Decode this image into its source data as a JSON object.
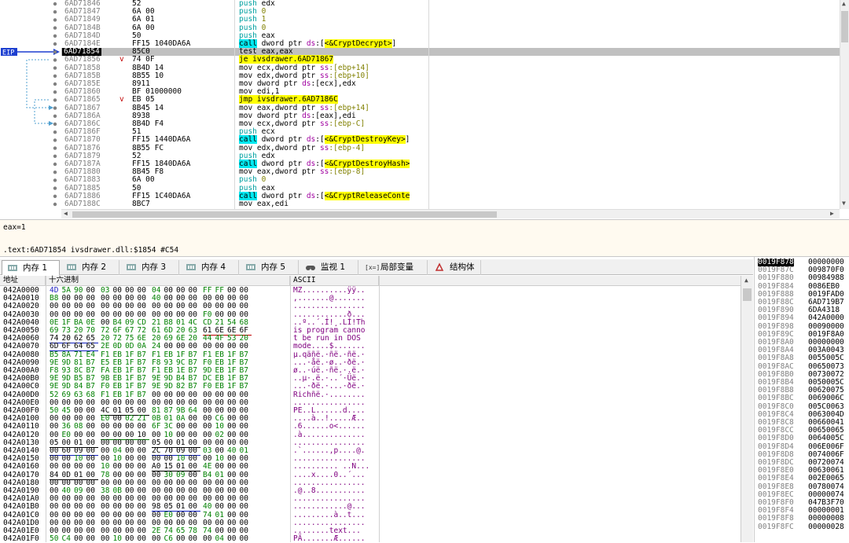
{
  "disasm": {
    "eip_label": "EIP",
    "rows": [
      {
        "addr": "6AD71846",
        "hex": "52",
        "ins": [
          {
            "t": "push",
            "c": "kw-push"
          },
          {
            "t": " edx"
          }
        ]
      },
      {
        "addr": "6AD71847",
        "hex": "6A 00",
        "ins": [
          {
            "t": "push",
            "c": "kw-push"
          },
          {
            "t": " "
          },
          {
            "t": "0",
            "c": "imm"
          }
        ]
      },
      {
        "addr": "6AD71849",
        "hex": "6A 01",
        "ins": [
          {
            "t": "push",
            "c": "kw-push"
          },
          {
            "t": " "
          },
          {
            "t": "1",
            "c": "imm"
          }
        ]
      },
      {
        "addr": "6AD7184B",
        "hex": "6A 00",
        "ins": [
          {
            "t": "push",
            "c": "kw-push"
          },
          {
            "t": " "
          },
          {
            "t": "0",
            "c": "imm"
          }
        ]
      },
      {
        "addr": "6AD7184D",
        "hex": "50",
        "ins": [
          {
            "t": "push",
            "c": "kw-push"
          },
          {
            "t": " eax"
          }
        ]
      },
      {
        "addr": "6AD7184E",
        "hex": "FF15 1040DA6A",
        "ins": [
          {
            "t": "call",
            "c": "kw-call"
          },
          {
            "t": " dword ptr "
          },
          {
            "t": "ds",
            "c": "seg"
          },
          {
            "t": ":["
          },
          {
            "t": "<&CryptDecrypt>",
            "c": "apiname"
          },
          {
            "t": "]"
          }
        ]
      },
      {
        "addr": "6AD71854",
        "hex": "85C0",
        "cur": true,
        "ins": [
          {
            "t": "test eax,eax"
          }
        ]
      },
      {
        "addr": "6AD71856",
        "hex": "74 0F",
        "mark": "v",
        "ins": [
          {
            "t": "je ivsdrawer.6AD71867",
            "c": "kw-jmp"
          }
        ]
      },
      {
        "addr": "6AD71858",
        "hex": "8B4D 14",
        "ins": [
          {
            "t": "mov ecx,dword ptr "
          },
          {
            "t": "ss",
            "c": "seg"
          },
          {
            "t": ":[ebp+14]",
            "c": "imm"
          }
        ]
      },
      {
        "addr": "6AD7185B",
        "hex": "8B55 10",
        "ins": [
          {
            "t": "mov edx,dword ptr "
          },
          {
            "t": "ss",
            "c": "seg"
          },
          {
            "t": ":[ebp+10]",
            "c": "imm"
          }
        ]
      },
      {
        "addr": "6AD7185E",
        "hex": "8911",
        "ins": [
          {
            "t": "mov dword ptr "
          },
          {
            "t": "ds",
            "c": "seg"
          },
          {
            "t": ":[ecx],edx"
          }
        ]
      },
      {
        "addr": "6AD71860",
        "hex": "BF 01000000",
        "ins": [
          {
            "t": "mov edi,1"
          }
        ]
      },
      {
        "addr": "6AD71865",
        "hex": "EB 05",
        "mark": "v",
        "ins": [
          {
            "t": "jmp ivsdrawer.6AD7186C",
            "c": "kw-jmp"
          }
        ]
      },
      {
        "addr": "6AD71867",
        "hex": "8B45 14",
        "ins": [
          {
            "t": "mov eax,dword ptr "
          },
          {
            "t": "ss",
            "c": "seg"
          },
          {
            "t": ":[ebp+14]",
            "c": "imm"
          }
        ]
      },
      {
        "addr": "6AD7186A",
        "hex": "8938",
        "ins": [
          {
            "t": "mov dword ptr "
          },
          {
            "t": "ds",
            "c": "seg"
          },
          {
            "t": ":[eax],edi"
          }
        ]
      },
      {
        "addr": "6AD7186C",
        "hex": "8B4D F4",
        "ins": [
          {
            "t": "mov ecx,dword ptr "
          },
          {
            "t": "ss",
            "c": "seg"
          },
          {
            "t": ":[ebp-C]",
            "c": "imm"
          }
        ]
      },
      {
        "addr": "6AD7186F",
        "hex": "51",
        "ins": [
          {
            "t": "push",
            "c": "kw-push"
          },
          {
            "t": " ecx"
          }
        ]
      },
      {
        "addr": "6AD71870",
        "hex": "FF15 1440DA6A",
        "ins": [
          {
            "t": "call",
            "c": "kw-call"
          },
          {
            "t": " dword ptr "
          },
          {
            "t": "ds",
            "c": "seg"
          },
          {
            "t": ":["
          },
          {
            "t": "<&CryptDestroyKey>",
            "c": "apiname"
          },
          {
            "t": "]"
          }
        ]
      },
      {
        "addr": "6AD71876",
        "hex": "8B55 FC",
        "ins": [
          {
            "t": "mov edx,dword ptr "
          },
          {
            "t": "ss",
            "c": "seg"
          },
          {
            "t": ":[ebp-4]",
            "c": "imm"
          }
        ]
      },
      {
        "addr": "6AD71879",
        "hex": "52",
        "ins": [
          {
            "t": "push",
            "c": "kw-push"
          },
          {
            "t": " edx"
          }
        ]
      },
      {
        "addr": "6AD7187A",
        "hex": "FF15 1840DA6A",
        "ins": [
          {
            "t": "call",
            "c": "kw-call"
          },
          {
            "t": " dword ptr "
          },
          {
            "t": "ds",
            "c": "seg"
          },
          {
            "t": ":["
          },
          {
            "t": "<&CryptDestroyHash>",
            "c": "apiname"
          }
        ]
      },
      {
        "addr": "6AD71880",
        "hex": "8B45 F8",
        "ins": [
          {
            "t": "mov eax,dword ptr "
          },
          {
            "t": "ss",
            "c": "seg"
          },
          {
            "t": ":[ebp-8]",
            "c": "imm"
          }
        ]
      },
      {
        "addr": "6AD71883",
        "hex": "6A 00",
        "ins": [
          {
            "t": "push",
            "c": "kw-push"
          },
          {
            "t": " "
          },
          {
            "t": "0",
            "c": "imm"
          }
        ]
      },
      {
        "addr": "6AD71885",
        "hex": "50",
        "ins": [
          {
            "t": "push",
            "c": "kw-push"
          },
          {
            "t": " eax"
          }
        ]
      },
      {
        "addr": "6AD71886",
        "hex": "FF15 1C40DA6A",
        "ins": [
          {
            "t": "call",
            "c": "kw-call"
          },
          {
            "t": " dword ptr "
          },
          {
            "t": "ds",
            "c": "seg"
          },
          {
            "t": ":["
          },
          {
            "t": "<&CryptReleaseConte",
            "c": "apiname"
          }
        ]
      },
      {
        "addr": "6AD7188C",
        "hex": "8BC7",
        "ins": [
          {
            "t": "mov eax,edi"
          }
        ]
      }
    ]
  },
  "info": {
    "line1": "eax=1",
    "line2": ".text:6AD71854 ivsdrawer.dll:$1854 #C54"
  },
  "tabs": [
    {
      "label": "内存 1",
      "active": true,
      "icon": "memory-icon"
    },
    {
      "label": "内存 2",
      "icon": "memory-icon"
    },
    {
      "label": "内存 3",
      "icon": "memory-icon"
    },
    {
      "label": "内存 4",
      "icon": "memory-icon"
    },
    {
      "label": "内存 5",
      "icon": "memory-icon"
    },
    {
      "label": "监视 1",
      "icon": "watch-icon"
    },
    {
      "label": "局部变量",
      "icon": "locals-icon"
    },
    {
      "label": "结构体",
      "icon": "struct-icon"
    }
  ],
  "dump": {
    "col_address": "地址",
    "col_hex": "十六进制",
    "col_ascii": "ASCII",
    "rows": [
      {
        "a": "042A0000",
        "h": "4D 5A 90 00 03 00 00 00 04 00 00 00 FF FF 00 00",
        "s": "MZ..........ÿÿ.."
      },
      {
        "a": "042A0010",
        "h": "B8 00 00 00 00 00 00 00 40 00 00 00 00 00 00 00",
        "s": ",.......@......."
      },
      {
        "a": "042A0020",
        "h": "00 00 00 00 00 00 00 00 00 00 00 00 00 00 00 00",
        "s": "................"
      },
      {
        "a": "042A0030",
        "h": "00 00 00 00 00 00 00 00 00 00 00 00 F0 00 00 00",
        "s": "............ð..."
      },
      {
        "a": "042A0040",
        "h": "0E 1F BA 0E 00 B4 09 CD 21 B8 01 4C CD 21 54 68",
        "s": "..º..´.Í!¸.LÍ!Th"
      },
      {
        "a": "042A0050",
        "h": "69 73 20 70 72 6F 67 72 61 6D 20 63 61 6E 6E 6F",
        "s": "is program canno"
      },
      {
        "a": "042A0060",
        "h": "74 20 62 65 20 72 75 6E 20 69 6E 20 44 4F 53 20",
        "s": "t be run in DOS "
      },
      {
        "a": "042A0070",
        "h": "6D 6F 64 65 2E 0D 0D 0A 24 00 00 00 00 00 00 00",
        "s": "mode....$......."
      },
      {
        "a": "042A0080",
        "h": "B5 8A 71 E4 F1 EB 1F B7 F1 EB 1F B7 F1 EB 1F B7",
        "s": "µ.qäñë.·ñë.·ñë.·"
      },
      {
        "a": "042A0090",
        "h": "9E 9D 81 B7 E5 EB 1F B7 F8 93 9C B7 F0 EB 1F B7",
        "s": "...·åë.·ø..·ðë.·"
      },
      {
        "a": "042A00A0",
        "h": "F8 93 8C B7 FA EB 1F B7 F1 EB 1E B7 9D EB 1F B7",
        "s": "ø..·úë.·ñë.·.ë.·"
      },
      {
        "a": "042A00B0",
        "h": "9E 9D B5 B7 9B EB 1F B7 9E 9D B4 B7 DC EB 1F B7",
        "s": "..µ·.ë.·..´·Üë.·"
      },
      {
        "a": "042A00C0",
        "h": "9E 9D 84 B7 F0 EB 1F B7 9E 9D 82 B7 F0 EB 1F B7",
        "s": "...·ðë.·...·ðë.·"
      },
      {
        "a": "042A00D0",
        "h": "52 69 63 68 F1 EB 1F B7 00 00 00 00 00 00 00 00",
        "s": "Richñë.·........"
      },
      {
        "a": "042A00E0",
        "h": "00 00 00 00 00 00 00 00 00 00 00 00 00 00 00 00",
        "s": "................"
      },
      {
        "a": "042A00F0",
        "h": "50 45 00 00 4C 01 05 00 81 87 9B 64 00 00 00 00",
        "s": "PE..L......d...."
      },
      {
        "a": "042A0100",
        "h": "00 00 00 00 E0 00 02 21 0B 01 0A 00 00 C6 00 00",
        "s": "....à..!.....Æ.."
      },
      {
        "a": "042A0110",
        "h": "00 36 08 00 00 00 00 00 6F 3C 00 00 00 10 00 00",
        "s": ".6......o<......"
      },
      {
        "a": "042A0120",
        "h": "00 E0 00 00 00 00 00 10 00 10 00 00 00 02 00 00",
        "s": ".à.............."
      },
      {
        "a": "042A0130",
        "h": "05 00 01 00 00 00 00 00 05 00 01 00 00 00 00 00",
        "s": "................"
      },
      {
        "a": "042A0140",
        "h": "00 60 09 00 00 04 00 00 2C 70 09 00 03 00 40 01",
        "s": ".`......,p....@."
      },
      {
        "a": "042A0150",
        "h": "00 00 10 00 00 10 00 00 00 00 10 00 00 10 00 00",
        "s": "................"
      },
      {
        "a": "042A0160",
        "h": "00 00 00 00 10 00 00 00 A0 15 01 00 4E 00 00 00",
        "s": ".......... ..N..."
      },
      {
        "a": "042A0170",
        "h": "84 0D 01 00 78 00 00 00 00 30 09 00 B4 01 00 00",
        "s": "....x....0..´..."
      },
      {
        "a": "042A0180",
        "h": "00 00 00 00 00 00 00 00 00 00 00 00 00 00 00 00",
        "s": "................"
      },
      {
        "a": "042A0190",
        "h": "00 40 09 00 38 0B 00 00 00 00 00 00 00 00 00 00",
        "s": ".@..8..........."
      },
      {
        "a": "042A01A0",
        "h": "00 00 00 00 00 00 00 00 00 00 00 00 00 00 00 00",
        "s": "................"
      },
      {
        "a": "042A01B0",
        "h": "00 00 00 00 00 00 00 00 98 05 01 00 40 00 00 00",
        "s": "............@..."
      },
      {
        "a": "042A01C0",
        "h": "00 00 00 00 00 00 00 00 00 E0 00 00 74 01 00 00",
        "s": ".........à..t..."
      },
      {
        "a": "042A01D0",
        "h": "00 00 00 00 00 00 00 00 00 00 00 00 00 00 00 00",
        "s": "................"
      },
      {
        "a": "042A01E0",
        "h": "00 00 00 00 00 00 00 00 2E 74 65 78 74 00 00 00",
        "s": "........text..."
      },
      {
        "a": "042A01F0",
        "h": "50 C4 00 00 00 10 00 00 00 C6 00 00 00 04 00 00",
        "s": "PÄ.......Æ......"
      }
    ]
  },
  "stack": {
    "rows": [
      {
        "a": "0019F878",
        "v": "00000000",
        "top": true
      },
      {
        "a": "0019F87C",
        "v": "009870F0"
      },
      {
        "a": "0019F880",
        "v": "00984988"
      },
      {
        "a": "0019F884",
        "v": "0086EB0"
      },
      {
        "a": "0019F888",
        "v": "0019FAD0"
      },
      {
        "a": "0019F88C",
        "v": "6AD719B7"
      },
      {
        "a": "0019F890",
        "v": "6DA4318"
      },
      {
        "a": "0019F894",
        "v": "042A0000"
      },
      {
        "a": "0019F898",
        "v": "00090000"
      },
      {
        "a": "0019F89C",
        "v": "0019F8A0"
      },
      {
        "a": "0019F8A0",
        "v": "00000000"
      },
      {
        "a": "0019F8A4",
        "v": "003A0043"
      },
      {
        "a": "0019F8A8",
        "v": "0055005C"
      },
      {
        "a": "0019F8AC",
        "v": "00650073"
      },
      {
        "a": "0019F8B0",
        "v": "00730072"
      },
      {
        "a": "0019F8B4",
        "v": "0050005C"
      },
      {
        "a": "0019F8B8",
        "v": "00620075"
      },
      {
        "a": "0019F8BC",
        "v": "0069006C"
      },
      {
        "a": "0019F8C0",
        "v": "005C0063"
      },
      {
        "a": "0019F8C4",
        "v": "0063004D"
      },
      {
        "a": "0019F8C8",
        "v": "00660041"
      },
      {
        "a": "0019F8CC",
        "v": "00650065"
      },
      {
        "a": "0019F8D0",
        "v": "0064005C"
      },
      {
        "a": "0019F8D4",
        "v": "006E006F"
      },
      {
        "a": "0019F8D8",
        "v": "0074006F"
      },
      {
        "a": "0019F8DC",
        "v": "00720074"
      },
      {
        "a": "0019F8E0",
        "v": "00630061"
      },
      {
        "a": "0019F8E4",
        "v": "002E0065"
      },
      {
        "a": "0019F8E8",
        "v": "00780074"
      },
      {
        "a": "0019F8EC",
        "v": "00000074"
      },
      {
        "a": "0019F8F0",
        "v": "047B3F70"
      },
      {
        "a": "0019F8F4",
        "v": "00000001"
      },
      {
        "a": "0019F8F8",
        "v": "00000008"
      },
      {
        "a": "0019F8FC",
        "v": "00000028"
      }
    ]
  }
}
